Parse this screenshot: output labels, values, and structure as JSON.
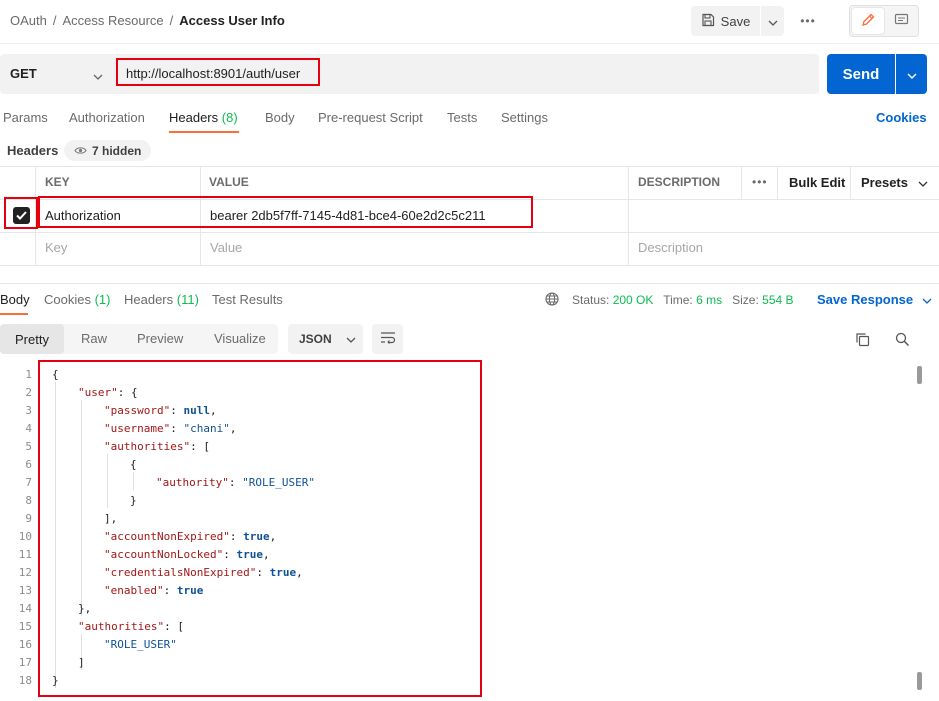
{
  "breadcrumb": {
    "root": "OAuth",
    "folder": "Access Resource",
    "current": "Access User Info"
  },
  "toolbar": {
    "save_label": "Save",
    "more_label": "•••"
  },
  "request": {
    "method": "GET",
    "url": "http://localhost:8901/auth/user",
    "send_label": "Send"
  },
  "request_tabs": {
    "params": "Params",
    "authorization": "Authorization",
    "headers": "Headers",
    "headers_count": "(8)",
    "body": "Body",
    "prerequest": "Pre-request Script",
    "tests": "Tests",
    "settings": "Settings",
    "cookies": "Cookies"
  },
  "headers_section": {
    "label": "Headers",
    "hidden": "7 hidden"
  },
  "headers_table": {
    "col_key": "KEY",
    "col_value": "VALUE",
    "col_description": "DESCRIPTION",
    "more": "•••",
    "bulk_edit": "Bulk Edit",
    "presets": "Presets",
    "row": {
      "key": "Authorization",
      "value": "bearer 2db5f7ff-7145-4d81-bce4-60e2d2c5c211",
      "checked": true
    },
    "placeholder": {
      "key": "Key",
      "value": "Value",
      "description": "Description"
    }
  },
  "response_tabs": {
    "body": "Body",
    "cookies": "Cookies",
    "cookies_count": "(1)",
    "headers": "Headers",
    "headers_count": "(11)",
    "test_results": "Test Results"
  },
  "response_meta": {
    "status_label": "Status:",
    "status_value": "200 OK",
    "time_label": "Time:",
    "time_value": "6 ms",
    "size_label": "Size:",
    "size_value": "554 B",
    "save_response": "Save Response"
  },
  "view_options": {
    "pretty": "Pretty",
    "raw": "Raw",
    "preview": "Preview",
    "visualize": "Visualize",
    "format": "JSON"
  },
  "code": {
    "line_numbers": [
      "1",
      "2",
      "3",
      "4",
      "5",
      "6",
      "7",
      "8",
      "9",
      "10",
      "11",
      "12",
      "13",
      "14",
      "15",
      "16",
      "17",
      "18"
    ],
    "l1": "{",
    "l2_key": "\"user\"",
    "l2_rest": ": {",
    "l3_key": "\"password\"",
    "l3_sep": ": ",
    "l3_val": "null",
    "l3_end": ",",
    "l4_key": "\"username\"",
    "l4_sep": ": ",
    "l4_val": "\"chani\"",
    "l4_end": ",",
    "l5_key": "\"authorities\"",
    "l5_rest": ": [",
    "l6": "{",
    "l7_key": "\"authority\"",
    "l7_sep": ": ",
    "l7_val": "\"ROLE_USER\"",
    "l8": "}",
    "l9": "],",
    "l10_key": "\"accountNonExpired\"",
    "l10_sep": ": ",
    "l10_val": "true",
    "l10_end": ",",
    "l11_key": "\"accountNonLocked\"",
    "l11_sep": ": ",
    "l11_val": "true",
    "l11_end": ",",
    "l12_key": "\"credentialsNonExpired\"",
    "l12_sep": ": ",
    "l12_val": "true",
    "l12_end": ",",
    "l13_key": "\"enabled\"",
    "l13_sep": ": ",
    "l13_val": "true",
    "l14": "},",
    "l15_key": "\"authorities\"",
    "l15_rest": ": [",
    "l16_val": "\"ROLE_USER\"",
    "l17": "]",
    "l18": "}"
  },
  "colors": {
    "accent": "#ff6c37",
    "primary": "#0265d2",
    "highlight": "#e3000f",
    "status_ok": "#0cbb52"
  },
  "icons": [
    "save-icon",
    "chevron-down-icon",
    "pencil-icon",
    "comment-icon",
    "eye-icon",
    "check-icon",
    "globe-icon",
    "wrap-icon",
    "copy-icon",
    "search-icon"
  ]
}
